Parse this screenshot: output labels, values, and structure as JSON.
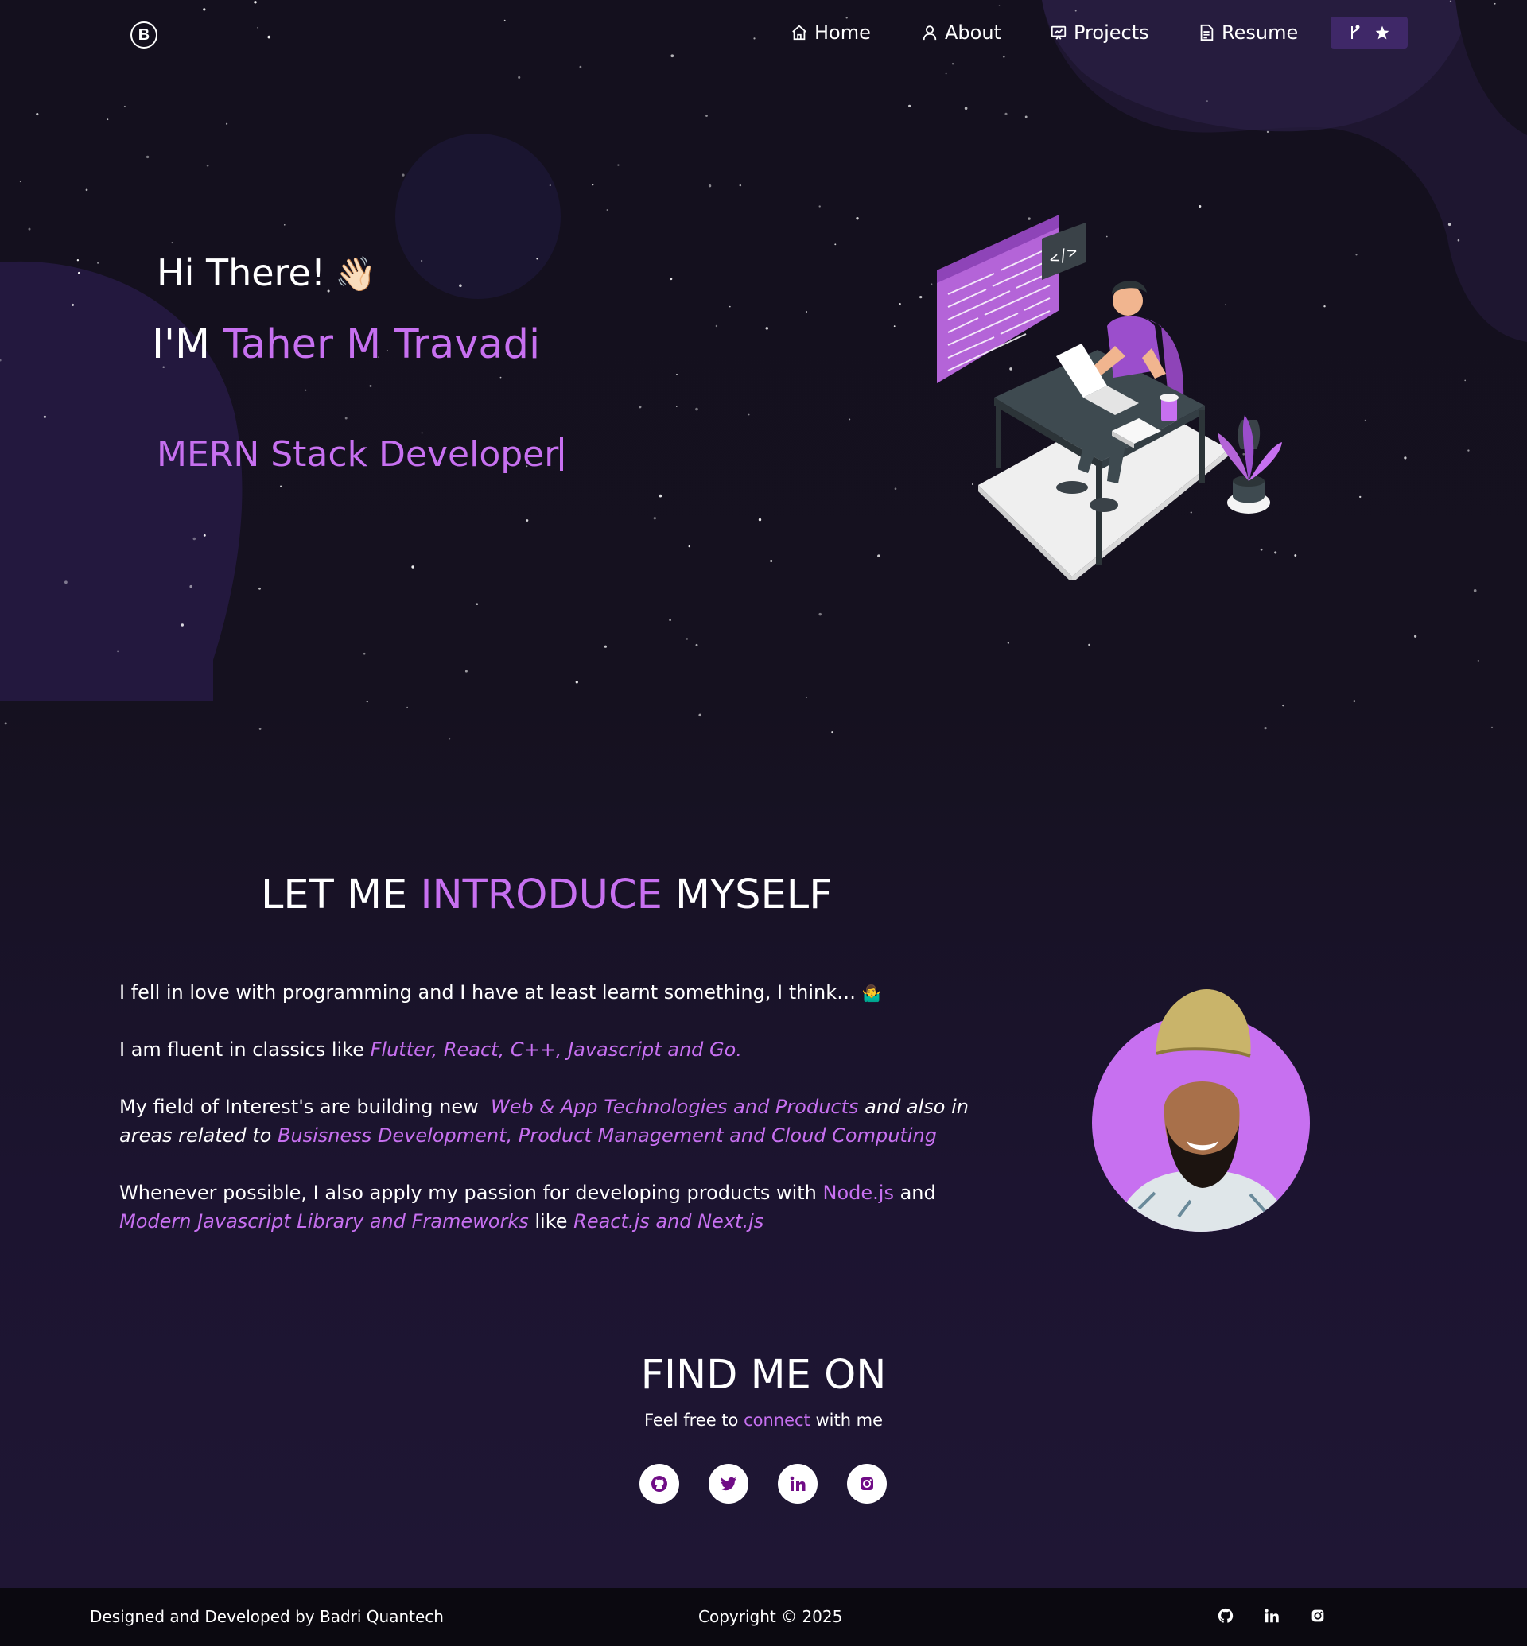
{
  "nav": {
    "logo": "B",
    "items": [
      {
        "label": "Home",
        "icon": "home-icon"
      },
      {
        "label": "About",
        "icon": "user-icon"
      },
      {
        "label": "Projects",
        "icon": "projects-icon"
      },
      {
        "label": "Resume",
        "icon": "resume-icon"
      }
    ],
    "star_button_icons": [
      "fork-icon",
      "star-icon"
    ]
  },
  "hero": {
    "greeting": "Hi There!",
    "wave_emoji": "👋🏻",
    "intro_prefix": "I'M ",
    "name": "Taher M Travadi",
    "role": "MERN Stack Developer"
  },
  "about": {
    "title_part1": "LET ME ",
    "title_accent": "INTRODUCE",
    "title_part2": " MYSELF",
    "p1_text": "I fell in love with programming and I have at least learnt something, I think… ",
    "p1_emoji": "🤷‍♂️",
    "p2_text": "I am fluent in classics like ",
    "p2_highlight": "Flutter, React, C++, Javascript and Go.",
    "p3_text": "My field of Interest's are building new ",
    "p3_highlight1": "Web & App Technologies and Products",
    "p3_mid": " and also in areas related to ",
    "p3_highlight2": "Busisness Development, Product Management and Cloud Computing",
    "p4_text": "Whenever possible, I also apply my passion for developing products with ",
    "p4_highlight1": "Node.js",
    "p4_and": " and ",
    "p4_highlight2": "Modern Javascript Library and Frameworks",
    "p4_like": " like ",
    "p4_highlight3": "React.js and Next.js"
  },
  "find": {
    "title": "FIND ME ON",
    "sub_prefix": "Feel free to ",
    "sub_link": "connect",
    "sub_suffix": " with me",
    "socials": [
      "github-icon",
      "twitter-icon",
      "linkedin-icon",
      "instagram-icon"
    ]
  },
  "footer": {
    "credit": "Designed and Developed by Badri Quantech",
    "copyright": "Copyright © 2025",
    "icons": [
      "github-icon",
      "linkedin-icon",
      "instagram-icon"
    ]
  },
  "colors": {
    "accent": "#c770f0",
    "background": "#14101e",
    "footer_bg": "#0b0910",
    "button_bg": "#3f2868"
  }
}
